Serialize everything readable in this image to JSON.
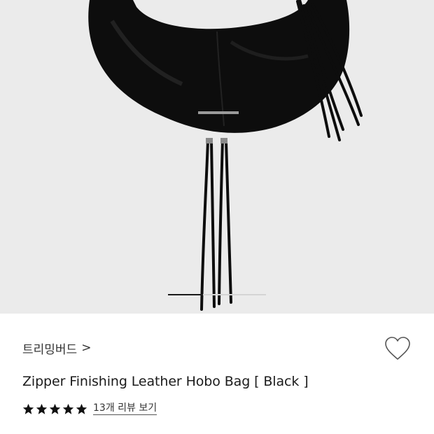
{
  "product": {
    "brand": "트리밍버드",
    "brand_chevron": ">",
    "title": "Zipper Finishing Leather Hobo Bag [ Black ]",
    "rating_stars": 5,
    "review_link": "13개 리뷰 보기"
  },
  "icons": {
    "brand": "chevron-right-icon",
    "wishlist": "heart-outline-icon",
    "rating": "star-icon"
  },
  "gallery": {
    "image_count": 3,
    "active_index": 0
  },
  "colors": {
    "image_bg": "#ebebeb",
    "star": "#111111",
    "text": "#1b1b1b"
  }
}
